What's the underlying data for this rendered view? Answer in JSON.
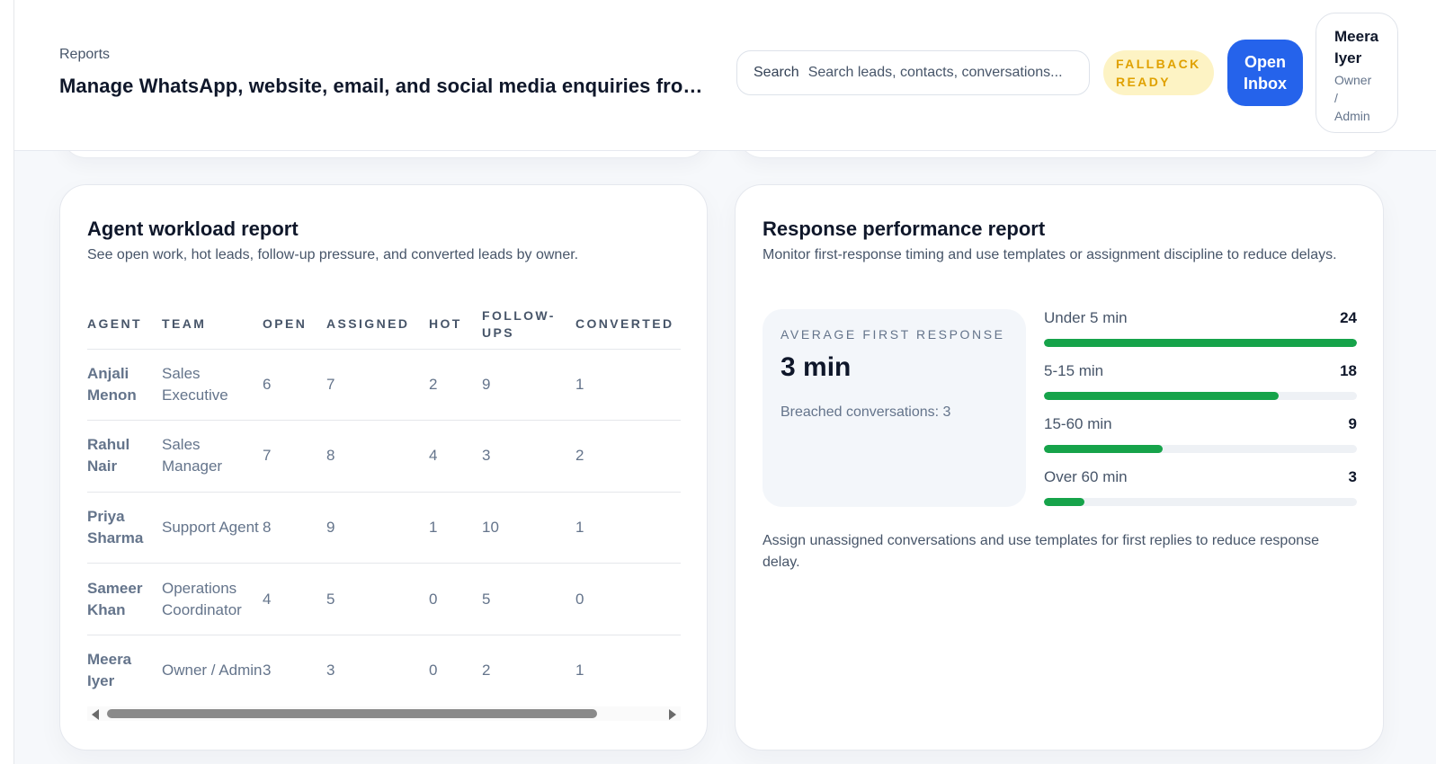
{
  "header": {
    "breadcrumb": "Reports",
    "title": "Manage WhatsApp, website, email, and social media enquiries from one place",
    "search_label": "Search",
    "search_placeholder": "Search leads, contacts, conversations...",
    "status_badge": "FALLBACK\nREADY",
    "open_inbox_label": "Open\nInbox",
    "user": {
      "name": "Meera\nIyer",
      "role": "Owner\n/\nAdmin"
    }
  },
  "workload": {
    "title": "Agent workload report",
    "subtitle": "See open work, hot leads, follow-up pressure, and converted leads by owner.",
    "columns": [
      "AGENT",
      "TEAM",
      "OPEN",
      "ASSIGNED",
      "HOT",
      "FOLLOW-UPS",
      "CONVERTED"
    ],
    "rows": [
      {
        "agent": "Anjali Menon",
        "team": "Sales Executive",
        "open": "6",
        "assigned": "7",
        "hot": "2",
        "followups": "9",
        "converted": "1"
      },
      {
        "agent": "Rahul Nair",
        "team": "Sales Manager",
        "open": "7",
        "assigned": "8",
        "hot": "4",
        "followups": "3",
        "converted": "2"
      },
      {
        "agent": "Priya Sharma",
        "team": "Support Agent",
        "open": "8",
        "assigned": "9",
        "hot": "1",
        "followups": "10",
        "converted": "1"
      },
      {
        "agent": "Sameer Khan",
        "team": "Operations Coordinator",
        "open": "4",
        "assigned": "5",
        "hot": "0",
        "followups": "5",
        "converted": "0"
      },
      {
        "agent": "Meera Iyer",
        "team": "Owner / Admin",
        "open": "3",
        "assigned": "3",
        "hot": "0",
        "followups": "2",
        "converted": "1"
      }
    ]
  },
  "response": {
    "title": "Response performance report",
    "subtitle": "Monitor first-response timing and use templates or assignment discipline to reduce delays.",
    "avg_label": "AVERAGE FIRST RESPONSE",
    "avg_value": "3 min",
    "breached": "Breached conversations: 3",
    "buckets": [
      {
        "label": "Under 5 min",
        "count": "24",
        "fraction": 1.0
      },
      {
        "label": "5-15 min",
        "count": "18",
        "fraction": 0.75
      },
      {
        "label": "15-60 min",
        "count": "9",
        "fraction": 0.38
      },
      {
        "label": "Over 60 min",
        "count": "3",
        "fraction": 0.13
      }
    ],
    "footer": "Assign unassigned conversations and use templates for first replies to reduce response delay."
  },
  "colors": {
    "accent": "#2563eb",
    "success": "#16a34a",
    "badge_bg": "#fdf3c4",
    "badge_text": "#e0a100"
  }
}
